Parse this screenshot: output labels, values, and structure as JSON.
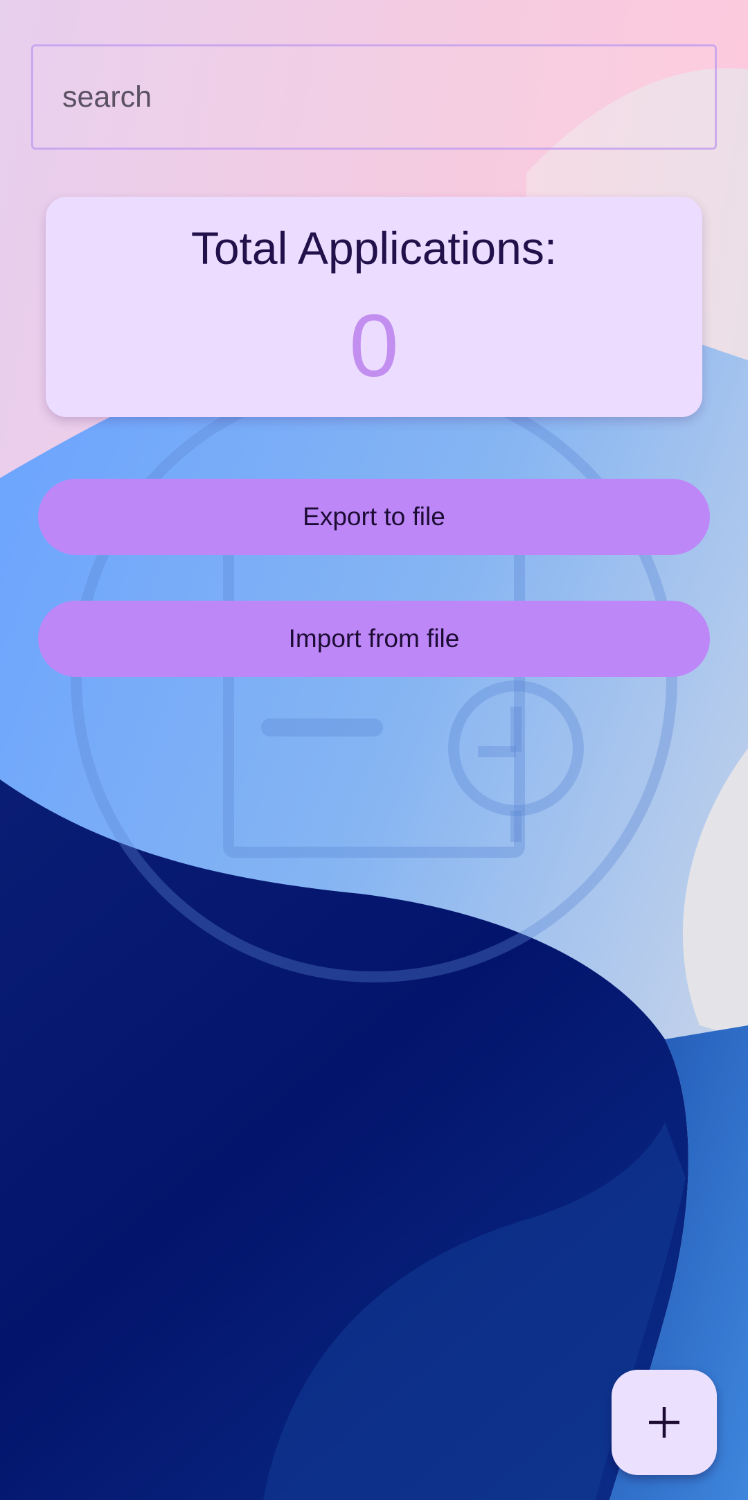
{
  "search": {
    "placeholder": "search",
    "value": ""
  },
  "summary": {
    "title": "Total Applications:",
    "count": "0"
  },
  "actions": {
    "export_label": "Export to file",
    "import_label": "Import from file"
  },
  "fab": {
    "icon": "plus-icon"
  },
  "colors": {
    "card_background": "#ecdcff",
    "title_text": "#22104a",
    "count_text": "#c28ef0",
    "button_background": "#bd87f8",
    "button_text": "#1c0c33",
    "fab_background": "#ece0ff"
  }
}
